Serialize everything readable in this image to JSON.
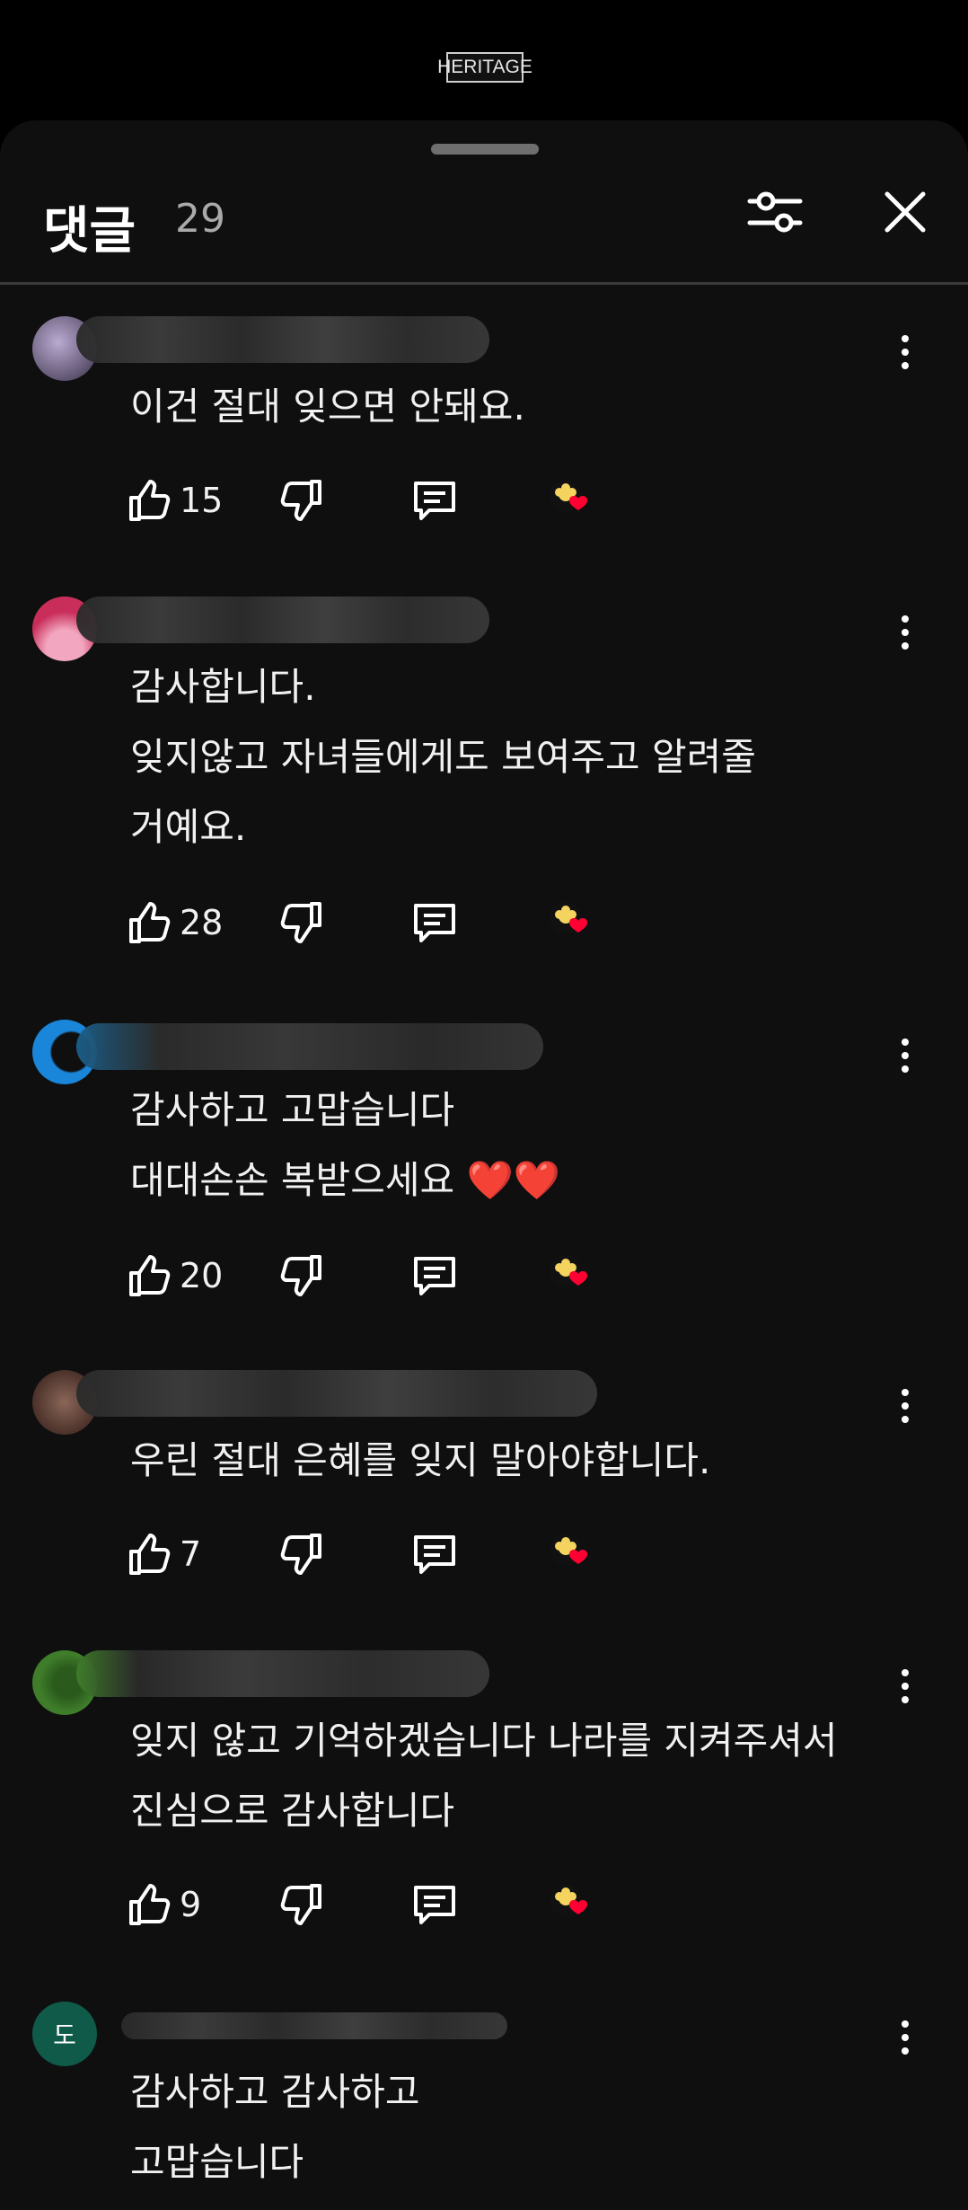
{
  "watermark": "HERITAGE",
  "header": {
    "title": "댓글",
    "count": "29"
  },
  "comments": [
    {
      "text": "이건 절대 잊으면 안돼요.",
      "likes": "15",
      "avatar_color": "#8e7fa6"
    },
    {
      "text": "감사합니다.\n잊지않고 자녀들에게도 보여주고 알려줄\n거예요.",
      "likes": "28",
      "avatar_color": "#c92e5a"
    },
    {
      "text": "감사하고 고맙습니다\n대대손손 복받으세요",
      "hearts": "❤️❤️",
      "likes": "20",
      "avatar_color": "#1a86d9"
    },
    {
      "text": "우린 절대 은혜를 잊지 말아야합니다.",
      "likes": "7",
      "avatar_color": "#6b4a3e"
    },
    {
      "text": "잊지 않고 기억하겠습니다 나라를 지켜주셔서\n진심으로 감사합니다",
      "likes": "9",
      "avatar_color": "#3f7d2a"
    },
    {
      "text": "감사하고 감사하고\n고맙습니다",
      "avatar_color": "#0f5a49",
      "avatar_letter": "도"
    }
  ],
  "colors": {
    "background": "#0f0f0f",
    "text": "#f1f1f1",
    "secondary": "#aaaaaa",
    "heart": "#ff0033",
    "creator_badge": "#f4d35e"
  },
  "icons": [
    "filter-sliders-icon",
    "close-icon",
    "thumbs-up-icon",
    "thumbs-down-icon",
    "reply-icon",
    "creator-heart-icon",
    "more-vert-icon"
  ]
}
